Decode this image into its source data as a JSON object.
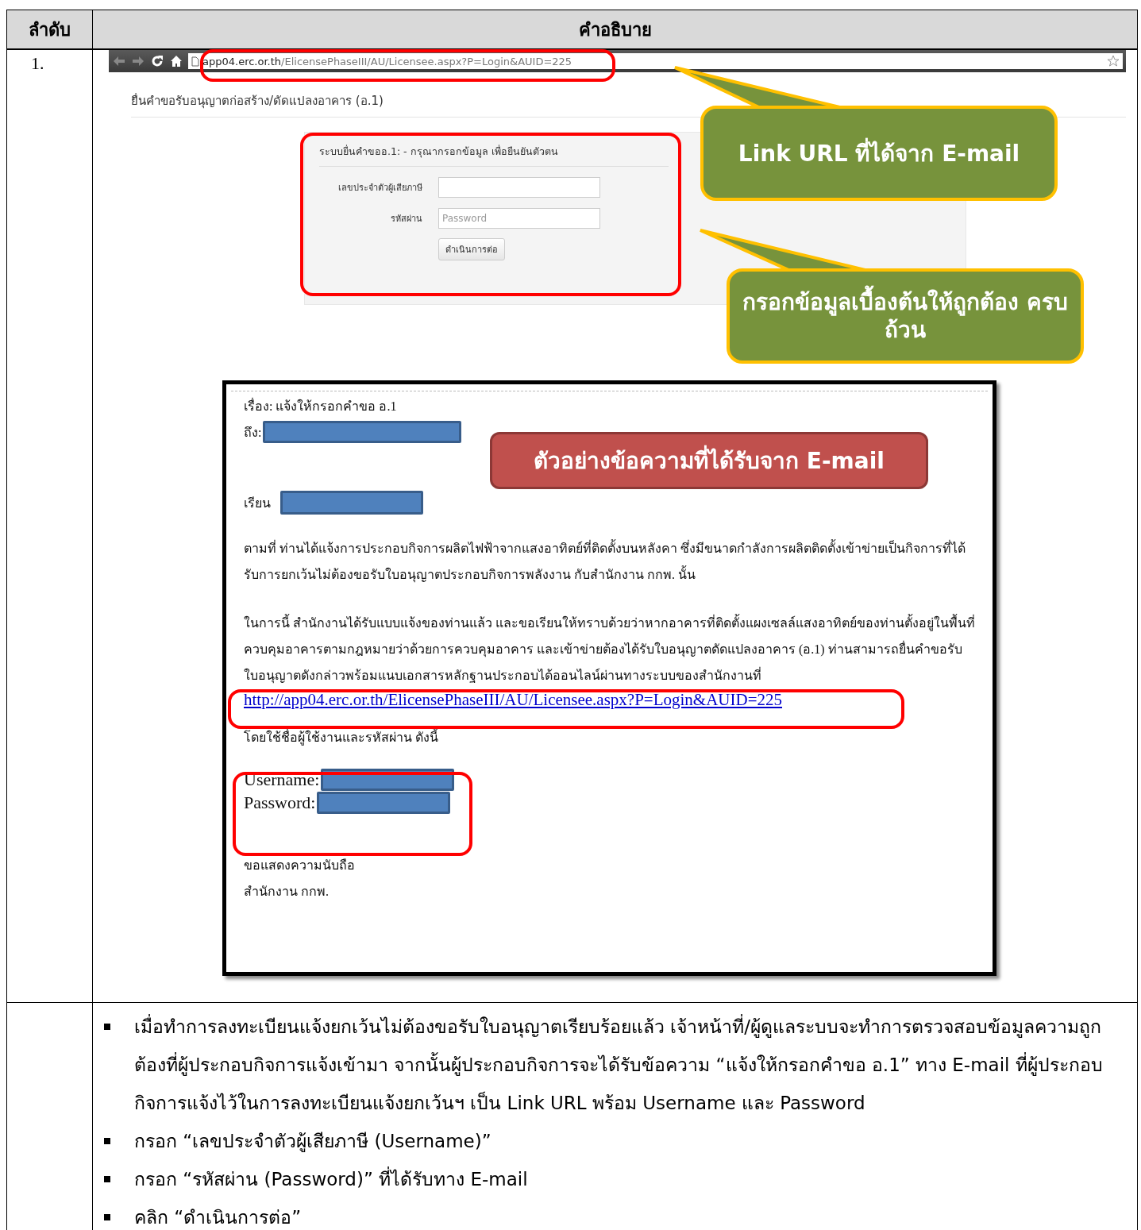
{
  "table": {
    "columns": [
      "ลำดับ",
      "คำอธิบาย"
    ],
    "rows": [
      {
        "number": "1.",
        "browser": {
          "url_host": "app04.erc.or.th",
          "url_path": "/ElicensePhaseIII/AU/Licensee.aspx?P=Login&AUID=225",
          "page_title": "ยื่นคำขอรับอนุญาตก่อสร้าง/ดัดแปลงอาคาร (อ.1)",
          "form": {
            "heading": "ระบบยื่นคำขออ.1: - กรุณากรอกข้อมูล เพื่อยืนยันตัวตน",
            "fields": [
              {
                "label": "เลขประจำตัวผู้เสียภาษี"
              },
              {
                "label": "รหัสผ่าน",
                "placeholder": "Password"
              }
            ],
            "button": "ดำเนินการต่อ"
          }
        },
        "callouts": [
          "Link URL ที่ได้จาก E-mail",
          "กรอกข้อมูลเบื้องต้นให้ถูกต้อง ครบถ้วน"
        ],
        "email": {
          "subject": "เรื่อง: แจ้งให้กรอกคำขอ อ.1",
          "to_label": "ถึง:",
          "label_banner": "ตัวอย่างข้อความที่ได้รับจาก E-mail",
          "salutation": "เรียน",
          "paragraphs": [
            "ตามที่ ท่านได้แจ้งการประกอบกิจการผลิตไฟฟ้าจากแสงอาทิตย์ที่ติดตั้งบนหลังคา ซึ่งมีขนาดกำลังการผลิตติดตั้งเข้าข่ายเป็นกิจการที่ได้รับการยกเว้นไม่ต้องขอรับใบอนุญาตประกอบกิจการพลังงาน กับสำนักงาน กกพ. นั้น",
            "ในการนี้ สำนักงานได้รับแบบแจ้งของท่านแล้ว และขอเรียนให้ทราบด้วยว่าหากอาคารที่ติดตั้งแผงเซลล์แสงอาทิตย์ของท่านตั้งอยู่ในพื้นที่ควบคุมอาคารตามกฎหมายว่าด้วยการควบคุมอาคาร และเข้าข่ายต้องได้รับใบอนุญาตดัดแปลงอาคาร (อ.1) ท่านสามารถยื่นคำขอรับใบอนุญาตดังกล่าวพร้อมแนบเอกสารหลักฐานประกอบได้ออนไลน์ผ่านทางระบบของสำนักงานที่"
          ],
          "link": "http://app04.erc.or.th/ElicensePhaseIII/AU/Licensee.aspx?P=Login&AUID=225",
          "credentials_intro": "โดยใช้ชื่อผู้ใช้งานและรหัสผ่าน ดังนี้",
          "credentials": [
            "Username:",
            "Password:"
          ],
          "closing": [
            "ขอแสดงความนับถือ",
            "สำนักงาน กกพ."
          ]
        }
      },
      {
        "bullets": [
          "เมื่อทำการลงทะเบียนแจ้งยกเว้นไม่ต้องขอรับใบอนุญาตเรียบร้อยแล้ว เจ้าหน้าที่/ผู้ดูแลระบบจะทำการตรวจสอบข้อมูลความถูกต้องที่ผู้ประกอบกิจการแจ้งเข้ามา จากนั้นผู้ประกอบกิจการจะได้รับข้อความ “แจ้งให้กรอกคำขอ อ.1” ทาง E-mail ที่ผู้ประกอบกิจการแจ้งไว้ในการลงทะเบียนแจ้งยกเว้นฯ เป็น Link URL พร้อม Username และ Password",
          "กรอก “เลขประจำตัวผู้เสียภาษี (Username)”",
          "กรอก “รหัสผ่าน (Password)” ที่ได้รับทาง E-mail",
          "คลิก “ดำเนินการต่อ”"
        ]
      }
    ]
  }
}
